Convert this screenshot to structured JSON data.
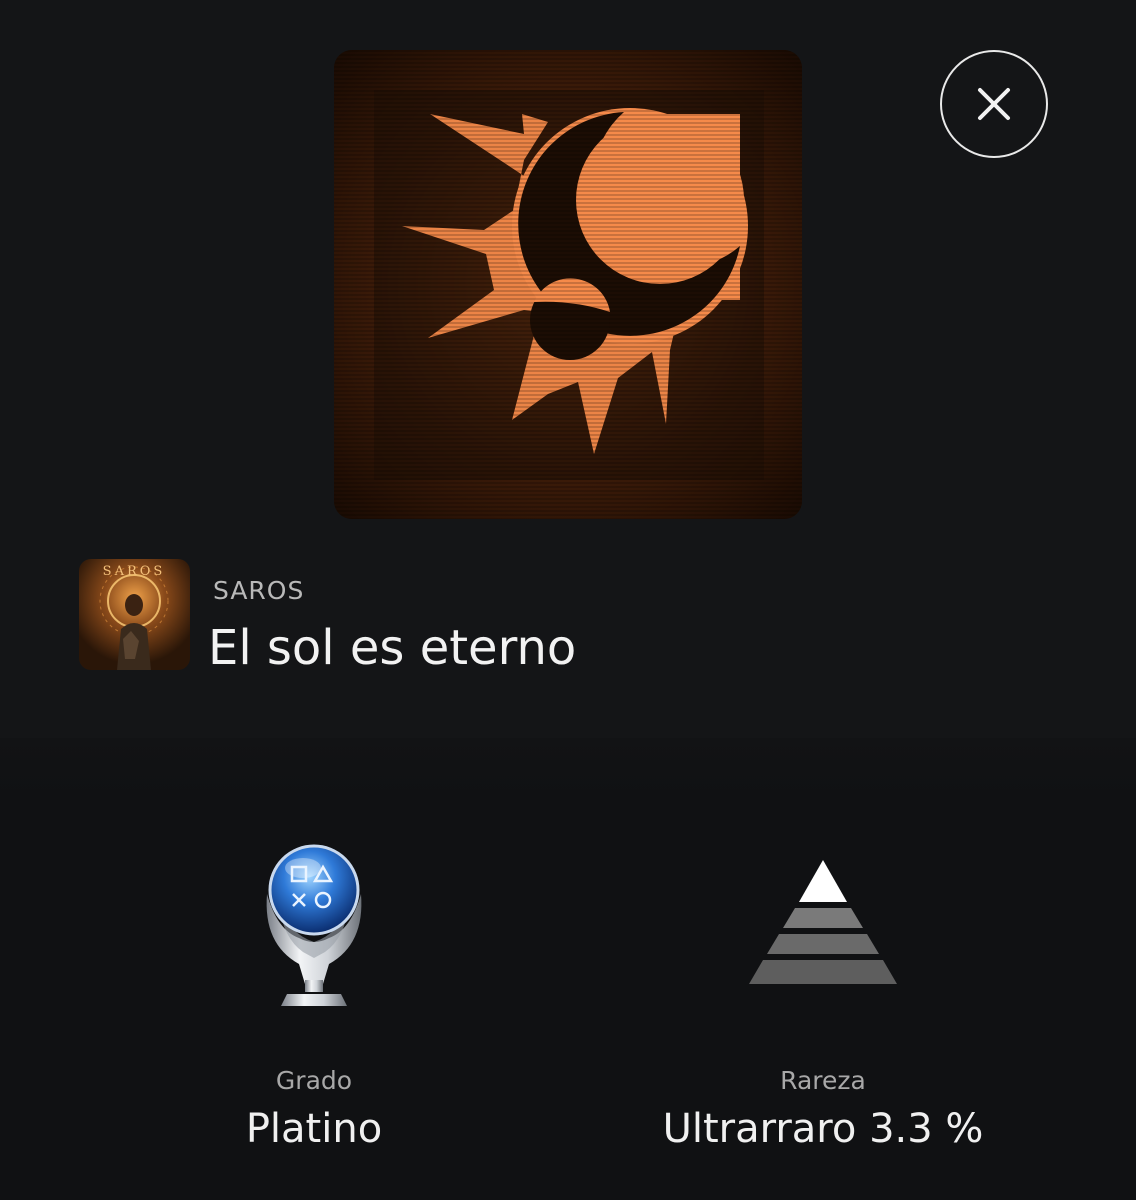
{
  "trophy": {
    "image_icon": "sun-moon-emblem-icon",
    "accent_color": "#f58a4a",
    "game_name": "SAROS",
    "game_thumb_text": "SAROS",
    "name": "El sol es eterno"
  },
  "close_button": {
    "icon": "close-icon"
  },
  "stats": {
    "grade": {
      "label": "Grado",
      "value": "Platino",
      "icon": "platinum-trophy-icon"
    },
    "rarity": {
      "label": "Rareza",
      "value": "Ultrarraro 3.3 %",
      "icon": "rarity-pyramid-icon"
    }
  }
}
